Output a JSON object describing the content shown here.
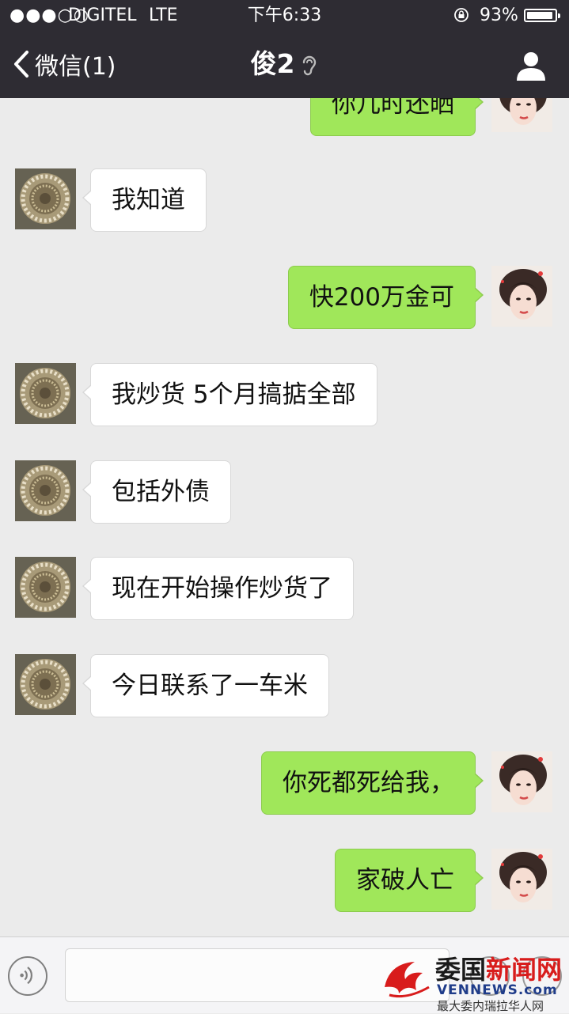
{
  "status_bar": {
    "signal_dots": "●●●○○",
    "carrier": "DIGITEL",
    "network": "LTE",
    "time": "下午6:33",
    "battery_percent": "93%",
    "battery_level": 0.93
  },
  "nav": {
    "back_label": "微信(1)",
    "title": "俊2"
  },
  "messages": [
    {
      "side": "out",
      "text": "你几时还晒"
    },
    {
      "side": "in",
      "text": "我知道"
    },
    {
      "side": "out",
      "text": "快200万金可"
    },
    {
      "side": "in",
      "text": "我炒货 5个月搞掂全部"
    },
    {
      "side": "in",
      "text": "包括外债"
    },
    {
      "side": "in",
      "text": "现在开始操作炒货了"
    },
    {
      "side": "in",
      "text": "今日联系了一车米"
    },
    {
      "side": "out",
      "text": "你死都死给我，"
    },
    {
      "side": "out",
      "text": "家破人亡"
    }
  ],
  "input": {
    "value": ""
  },
  "watermark": {
    "title_part1": "委国",
    "title_part2": "新闻网",
    "url": "VENNEWS.com",
    "subtitle": "最大委内瑞拉华人网"
  },
  "colors": {
    "header_bg": "#2e2c33",
    "chat_bg": "#ebebeb",
    "outgoing_bubble": "#a0e75a",
    "incoming_bubble": "#ffffff"
  }
}
